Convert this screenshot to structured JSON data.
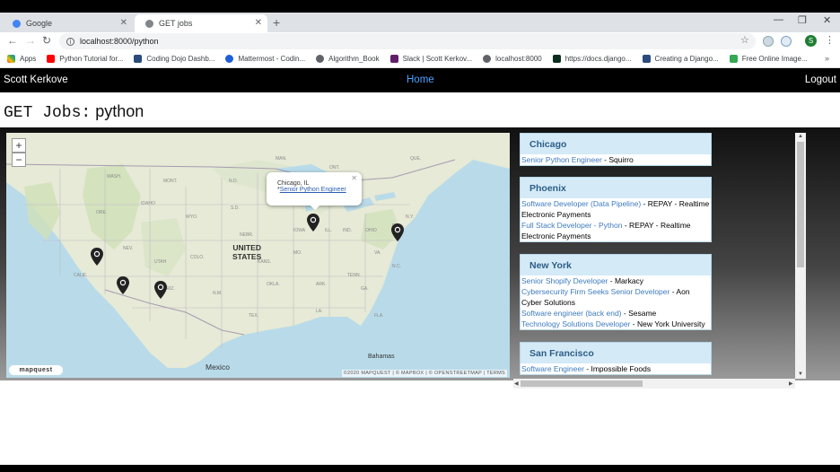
{
  "browser": {
    "tabs": [
      {
        "title": "Google",
        "icon": "google-icon",
        "active": false
      },
      {
        "title": "GET jobs",
        "icon": "globe-icon",
        "active": true
      }
    ],
    "url": "localhost:8000/python",
    "bookmarks": [
      {
        "label": "Apps",
        "icon": "apps-grid-icon"
      },
      {
        "label": "Python Tutorial for...",
        "icon": "youtube-icon"
      },
      {
        "label": "Coding Dojo Dashb...",
        "icon": "dojo-icon"
      },
      {
        "label": "Mattermost - Codin...",
        "icon": "mattermost-icon"
      },
      {
        "label": "Algorithm_Book",
        "icon": "globe-icon"
      },
      {
        "label": "Slack | Scott Kerkov...",
        "icon": "slack-icon"
      },
      {
        "label": "localhost:8000",
        "icon": "globe-icon"
      },
      {
        "label": "https://docs.django...",
        "icon": "django-icon"
      },
      {
        "label": "Creating a Django...",
        "icon": "dojo-icon"
      },
      {
        "label": "Free Online Image...",
        "icon": "image-icon"
      }
    ],
    "profile_initial": "S"
  },
  "navbar": {
    "brand": "Scott Kerkove",
    "home": "Home",
    "logout": "Logout"
  },
  "page": {
    "heading_prefix": "GET Jobs:",
    "heading_query": "python"
  },
  "map": {
    "popup_location": "Chicago, IL",
    "popup_job": "Senior Python Engineer",
    "labels": {
      "country": [
        "UNITED",
        "STATES"
      ],
      "mexico": "Mexico",
      "bahamas": "Bahamas"
    },
    "logo": "mapquest",
    "attribution": "©2020 MAPQUEST | © MAPBOX | © OPENSTREETMAP | TERMS",
    "zoom_in": "+",
    "zoom_out": "−"
  },
  "cities": [
    {
      "name": "Chicago",
      "jobs": [
        {
          "title": "Senior Python Engineer",
          "company": " - Squirro"
        }
      ]
    },
    {
      "name": "Phoenix",
      "jobs": [
        {
          "title": "Software Developer (Data Pipeline)",
          "company": " - REPAY - Realtime Electronic Payments"
        },
        {
          "title": "Full Stack Developer - Python",
          "company": " - REPAY - Realtime Electronic Payments"
        }
      ]
    },
    {
      "name": "New York",
      "jobs": [
        {
          "title": "Senior Shopify Developer",
          "company": " - Markacy"
        },
        {
          "title": "Cybersecurity Firm Seeks Senior Developer",
          "company": " - Aon Cyber Solutions"
        },
        {
          "title": "Software engineer (back end)",
          "company": " - Sesame"
        },
        {
          "title": "Technology Solutions Developer",
          "company": " - New York University"
        }
      ]
    },
    {
      "name": "San Francisco",
      "jobs": [
        {
          "title": "Software Engineer",
          "company": " - Impossible Foods"
        }
      ]
    }
  ]
}
